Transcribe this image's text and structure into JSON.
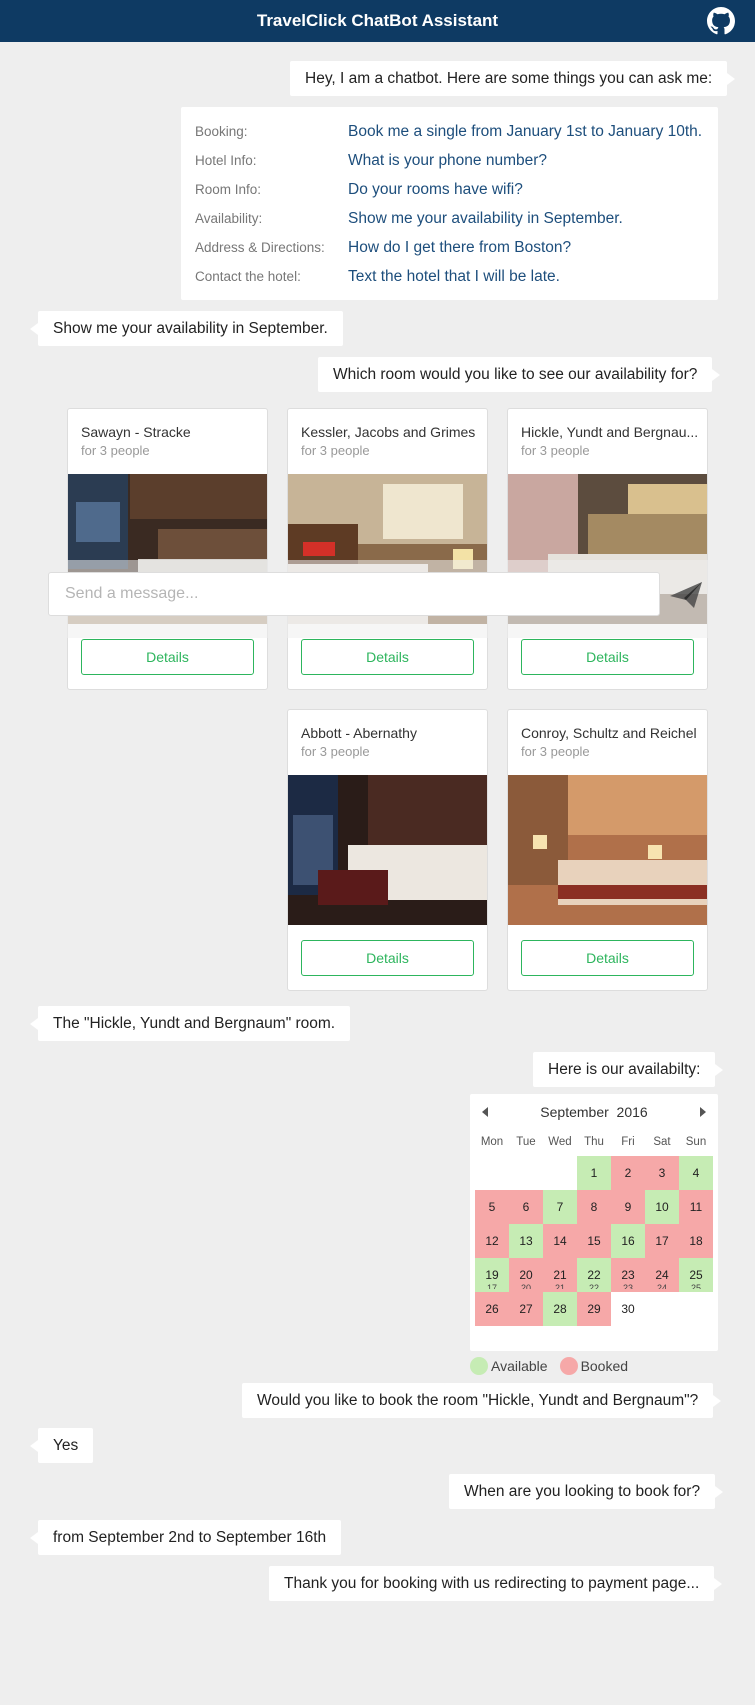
{
  "app": {
    "title": "TravelClick ChatBot Assistant"
  },
  "messages": {
    "intro": "Hey, I am a chatbot. Here are some things you can ask me:",
    "user_availability": "Show me your availability in September.",
    "which_room": "Which room would you like to see our availability for?",
    "user_room": "The \"Hickle, Yundt and Bergnaum\" room.",
    "here_avail": "Here is our availabilty:",
    "book_q": "Would you like to book the room \"Hickle, Yundt and Bergnaum\"?",
    "yes": "Yes",
    "when_q": "When are you looking to book for?",
    "dates": "from September 2nd to September 16th",
    "thanks": "Thank you for booking with us redirecting to payment page..."
  },
  "examples": [
    {
      "label": "Booking:",
      "question": "Book me a single from January 1st to January 10th."
    },
    {
      "label": "Hotel Info:",
      "question": "What is your phone number?"
    },
    {
      "label": "Room Info:",
      "question": "Do your rooms have wifi?"
    },
    {
      "label": "Availability:",
      "question": "Show me your availability in September."
    },
    {
      "label": "Address & Directions:",
      "question": "How do I get there from Boston?"
    },
    {
      "label": "Contact the hotel:",
      "question": "Text the hotel that I will be late."
    }
  ],
  "rooms": [
    {
      "name": "Sawayn - Stracke",
      "capacity": "for 3 people",
      "button": "Details"
    },
    {
      "name": "Kessler, Jacobs and Grimes",
      "capacity": "for 3 people",
      "button": "Details"
    },
    {
      "name": "Hickle, Yundt and Bergnau...",
      "capacity": "for 3 people",
      "button": "Details"
    },
    {
      "name": "Abbott - Abernathy",
      "capacity": "for 3 people",
      "button": "Details"
    },
    {
      "name": "Conroy, Schultz and Reichel",
      "capacity": "for 3 people",
      "button": "Details"
    }
  ],
  "composer": {
    "placeholder": "Send a message..."
  },
  "calendar": {
    "month": "September",
    "year": "2016",
    "weekdays": [
      "Mon",
      "Tue",
      "Wed",
      "Thu",
      "Fri",
      "Sat",
      "Sun"
    ],
    "first_weekday_index": 3,
    "days": [
      {
        "d": "1",
        "s": "a"
      },
      {
        "d": "2",
        "s": "b"
      },
      {
        "d": "3",
        "s": "b"
      },
      {
        "d": "4",
        "s": "a"
      },
      {
        "d": "5",
        "s": "b"
      },
      {
        "d": "6",
        "s": "b"
      },
      {
        "d": "7",
        "s": "a"
      },
      {
        "d": "8",
        "s": "b"
      },
      {
        "d": "9",
        "s": "b"
      },
      {
        "d": "10",
        "s": "a"
      },
      {
        "d": "11",
        "s": "b"
      },
      {
        "d": "12",
        "s": "b"
      },
      {
        "d": "13",
        "s": "a"
      },
      {
        "d": "14",
        "s": "b"
      },
      {
        "d": "15",
        "s": "b"
      },
      {
        "d": "16",
        "s": "a"
      },
      {
        "d": "17",
        "s": "b"
      },
      {
        "d": "18",
        "s": "b"
      },
      {
        "d": "19",
        "s": "a"
      },
      {
        "d": "20",
        "s": "b"
      },
      {
        "d": "21",
        "s": "b"
      },
      {
        "d": "22",
        "s": "a"
      },
      {
        "d": "23",
        "s": "b"
      },
      {
        "d": "24",
        "s": "b"
      },
      {
        "d": "25",
        "s": "a"
      },
      {
        "d": "26",
        "s": "b"
      },
      {
        "d": "27",
        "s": "b"
      },
      {
        "d": "28",
        "s": "a"
      },
      {
        "d": "29",
        "s": "b"
      },
      {
        "d": "30",
        "s": ""
      }
    ],
    "ghost_row": [
      "17",
      "20",
      "21",
      "22",
      "23",
      "24",
      "25"
    ]
  },
  "legend": {
    "available": "Available",
    "booked": "Booked"
  },
  "colors": {
    "header": "#0e3a63",
    "link": "#1d4e7c",
    "button": "#2db55d",
    "available": "#c6ecb4",
    "booked": "#f6a8a8"
  }
}
